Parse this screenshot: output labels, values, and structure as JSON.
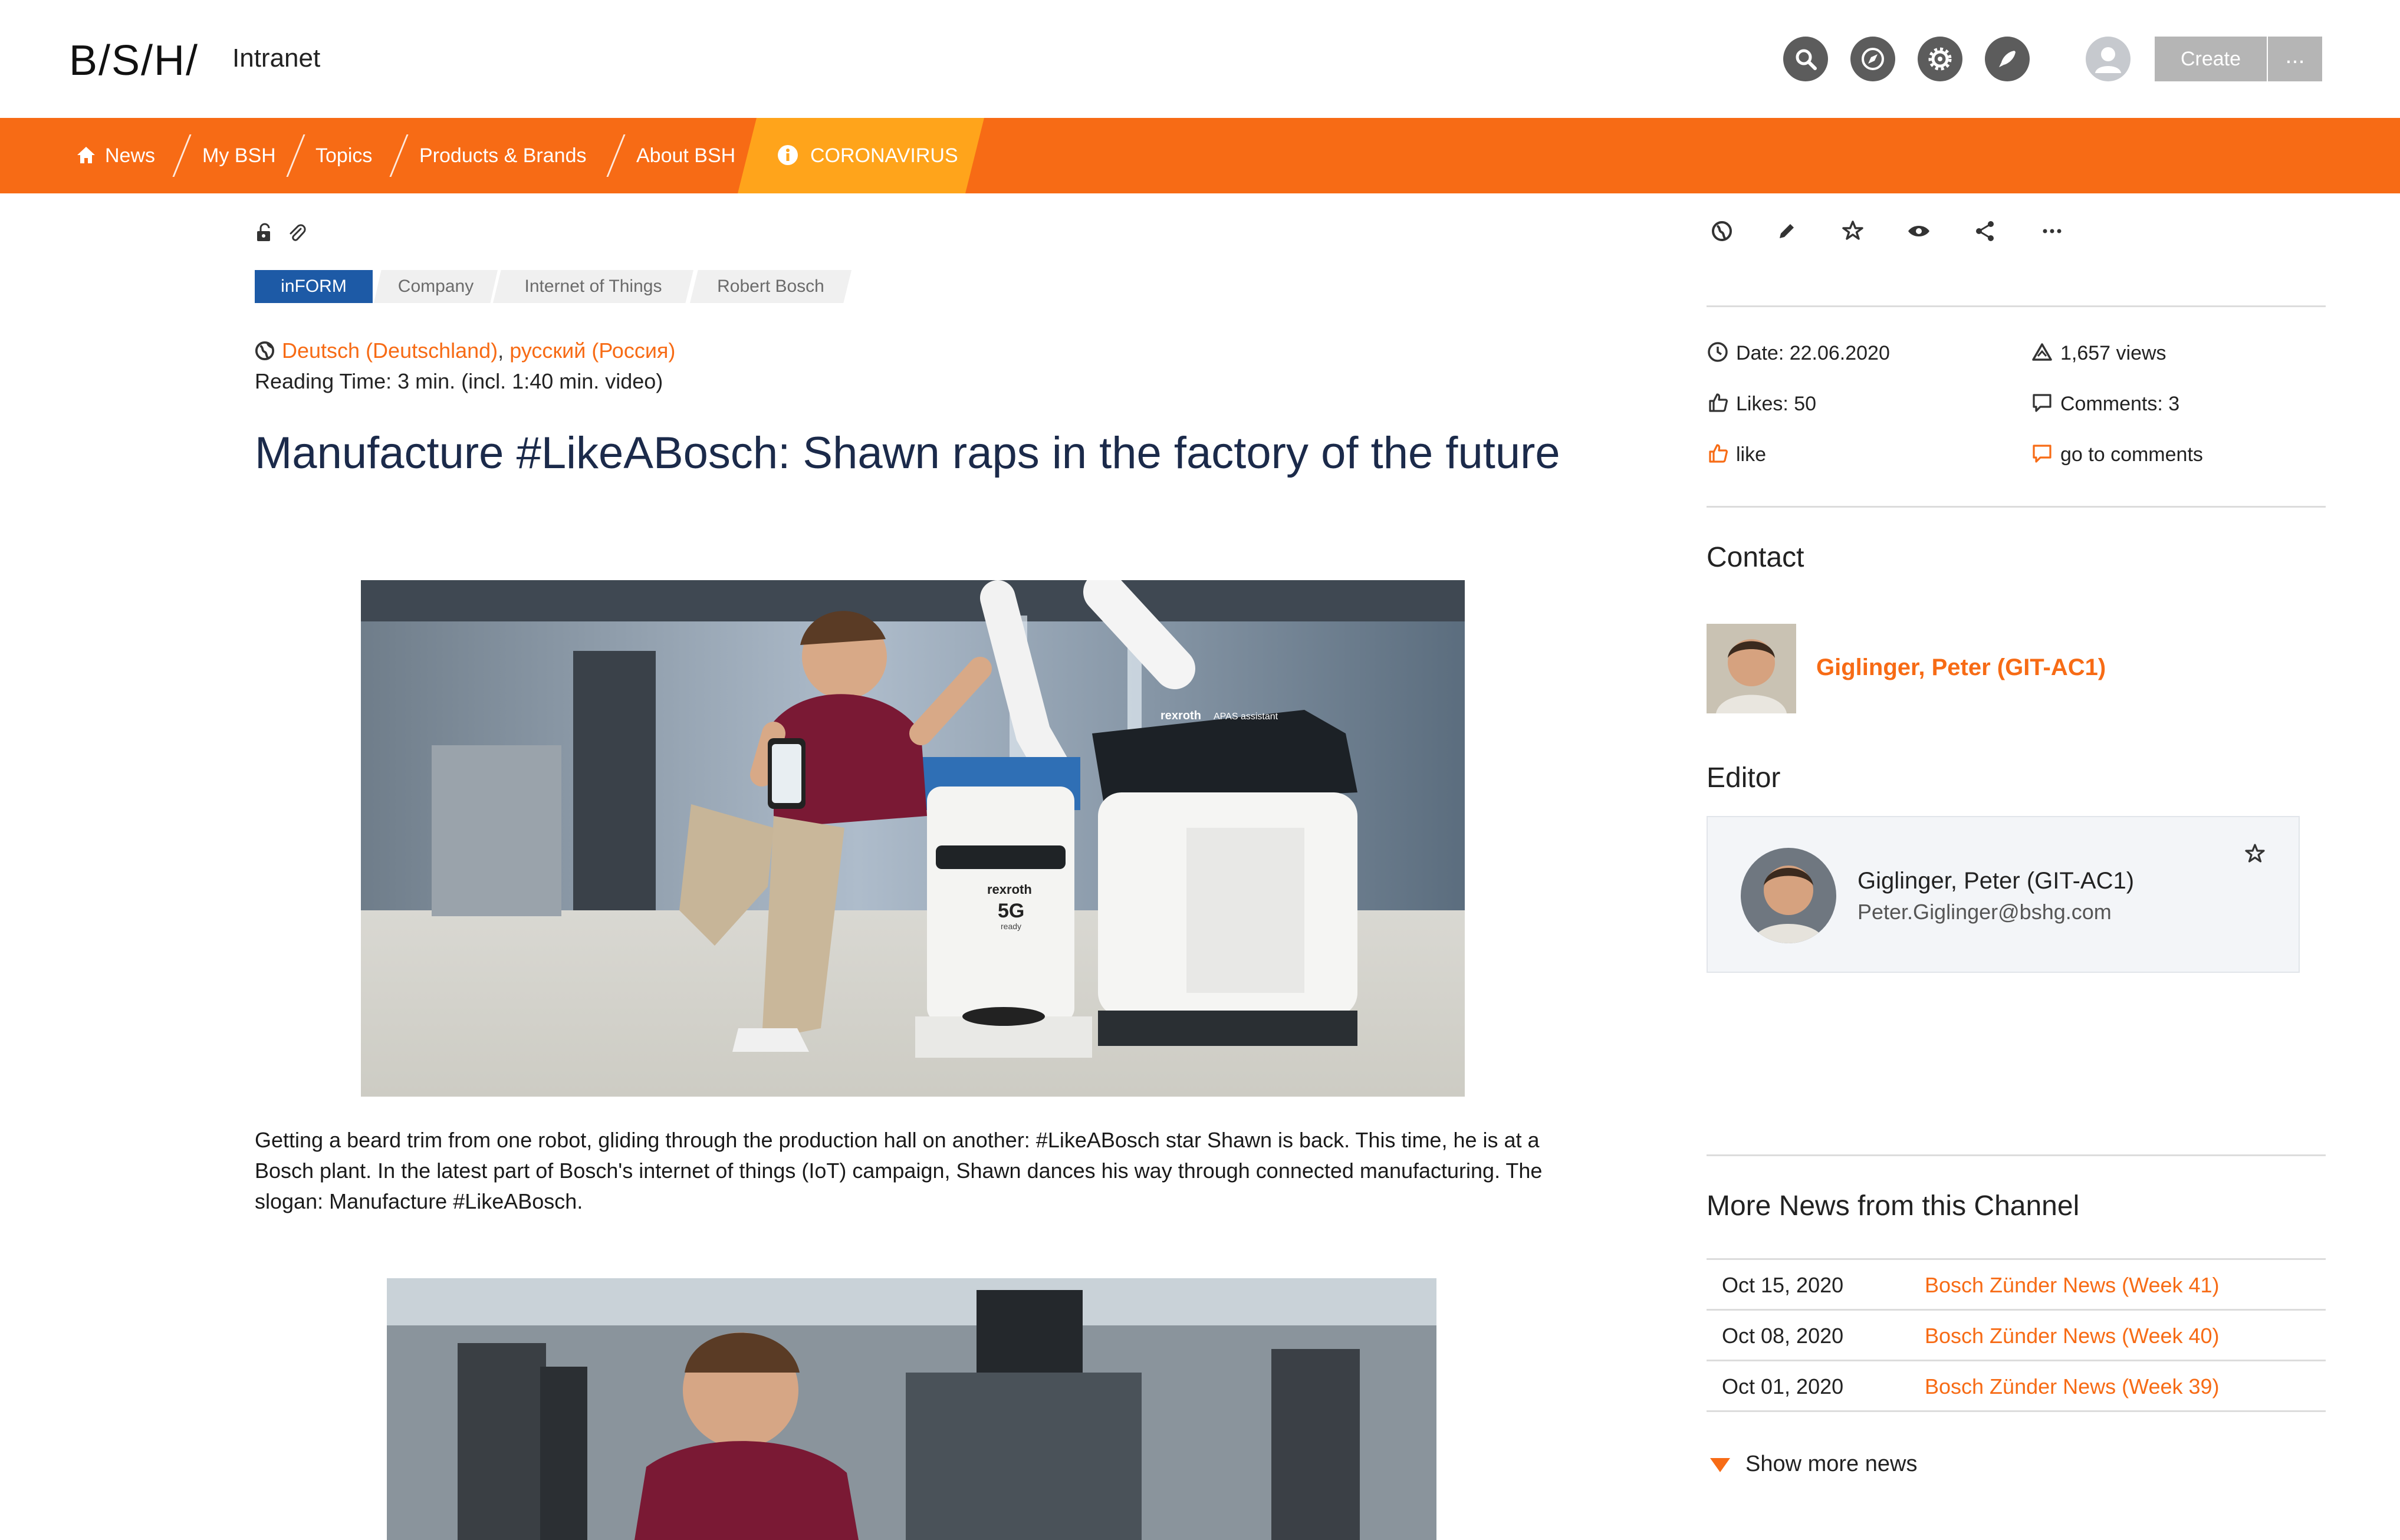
{
  "header": {
    "logo": "B/S/H/",
    "app_name": "Intranet",
    "icons": [
      "search-icon",
      "compass-icon",
      "gear-icon",
      "rocket-icon",
      "user-avatar-icon"
    ],
    "create_label": "Create",
    "more_label": "..."
  },
  "nav": {
    "items": [
      {
        "label": "News",
        "icon": "home-icon"
      },
      {
        "label": "My BSH"
      },
      {
        "label": "Topics"
      },
      {
        "label": "Products & Brands"
      },
      {
        "label": "About BSH"
      }
    ],
    "highlight": {
      "label": "CORONAVIRUS",
      "icon": "info-icon"
    }
  },
  "article": {
    "tags": [
      "inFORM",
      "Company",
      "Internet of Things",
      "Robert Bosch"
    ],
    "languages": [
      "Deutsch (Deutschland)",
      "русский (Россия)"
    ],
    "lang_separator": ",",
    "reading_time": "Reading Time: 3 min. (incl. 1:40 min. video)",
    "title": "Manufacture #LikeABosch: Shawn raps in the factory of the future",
    "body": "Getting a beard trim from one robot, gliding through the production hall on another: #LikeABosch star Shawn is back. This time, he is at a Bosch plant. In the latest part of Bosch's internet of things (IoT) campaign, Shawn dances his way through connected manufacturing. The slogan: Manufacture #LikeABosch.",
    "image_labels": {
      "brand": "rexroth",
      "assistant": "APAS assistant",
      "badge": "5G",
      "badge_sub": "ready"
    }
  },
  "sidebar": {
    "actions": [
      "globe-icon",
      "pencil-icon",
      "star-icon",
      "eye-icon",
      "share-icon",
      "more-icon"
    ],
    "date": "Date: 22.06.2020",
    "views": "1,657 views",
    "likes": "Likes: 50",
    "comments": "Comments: 3",
    "like_link": "like",
    "comments_link": "go to comments",
    "contact_heading": "Contact",
    "contact_name": "Giglinger, Peter (GIT-AC1)",
    "editor_heading": "Editor",
    "editor_name": "Giglinger, Peter (GIT-AC1)",
    "editor_email": "Peter.Giglinger@bshg.com",
    "more_news_heading": "More News from this Channel",
    "news": [
      {
        "date": "Oct 15, 2020",
        "title": "Bosch Zünder News (Week 41)"
      },
      {
        "date": "Oct 08, 2020",
        "title": "Bosch Zünder News (Week 40)"
      },
      {
        "date": "Oct 01, 2020",
        "title": "Bosch Zünder News (Week 39)"
      }
    ],
    "show_more": "Show more news"
  },
  "colors": {
    "brand_orange": "#f76b15",
    "corona_yellow": "#ffa41b",
    "tag_blue": "#1d5aa6",
    "headline_navy": "#1b2a4a"
  }
}
